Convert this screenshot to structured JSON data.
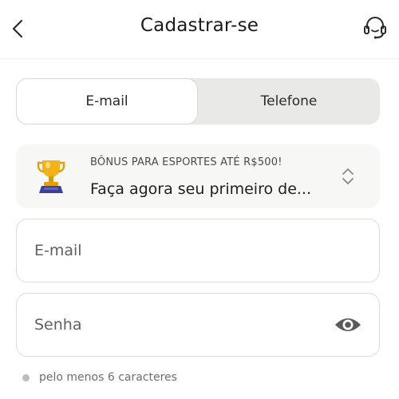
{
  "header": {
    "title": "Cadastrar-se",
    "back_icon": "chevron-left-icon",
    "support_icon": "headset-icon"
  },
  "tabs": [
    {
      "label": "E-mail",
      "active": true
    },
    {
      "label": "Telefone",
      "active": false
    }
  ],
  "promo": {
    "icon": "trophy-icon",
    "headline": "BÔNUS PARA ESPORTES ATÉ R$500!",
    "text": "Faça agora seu primeiro de...",
    "toggle_icon": "chevron-up-down-icon"
  },
  "form": {
    "email": {
      "value": "",
      "placeholder": "E-mail"
    },
    "password": {
      "value": "",
      "placeholder": "Senha",
      "toggle_icon": "eye-icon"
    }
  },
  "hint": {
    "text": "pelo menos 6 caracteres"
  },
  "colors": {
    "tab_track": "#e9e9e7",
    "promo_bg": "#f7f7f6",
    "border": "#dcdcdc",
    "trophy_gold": "#f2b21a",
    "trophy_base": "#3a3f99"
  }
}
